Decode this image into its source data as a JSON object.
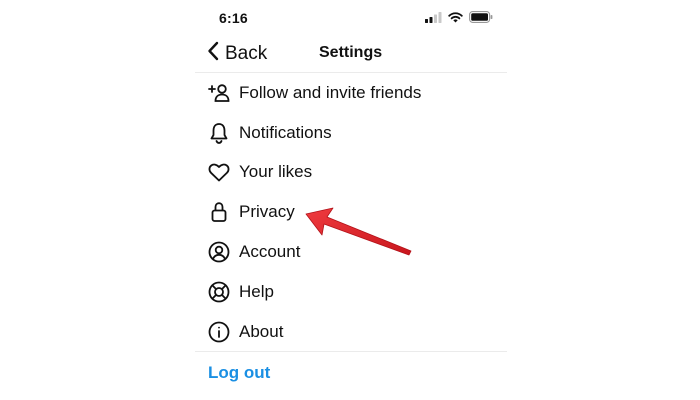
{
  "status_bar": {
    "time": "6:16",
    "icons": [
      "signal-icon",
      "wifi-icon",
      "battery-icon"
    ]
  },
  "nav": {
    "back_label": "Back",
    "title": "Settings"
  },
  "menu": {
    "items": [
      {
        "label": "Follow and invite friends",
        "icon": "add-person-icon"
      },
      {
        "label": "Notifications",
        "icon": "bell-icon"
      },
      {
        "label": "Your likes",
        "icon": "heart-icon"
      },
      {
        "label": "Privacy",
        "icon": "lock-icon"
      },
      {
        "label": "Account",
        "icon": "account-circle-icon"
      },
      {
        "label": "Help",
        "icon": "lifebuoy-icon"
      },
      {
        "label": "About",
        "icon": "info-icon"
      }
    ]
  },
  "logout_label": "Log out",
  "colors": {
    "link": "#1a8fe3",
    "annotation_arrow": "#e8232b",
    "text": "#111111",
    "divider": "#ebebeb"
  }
}
